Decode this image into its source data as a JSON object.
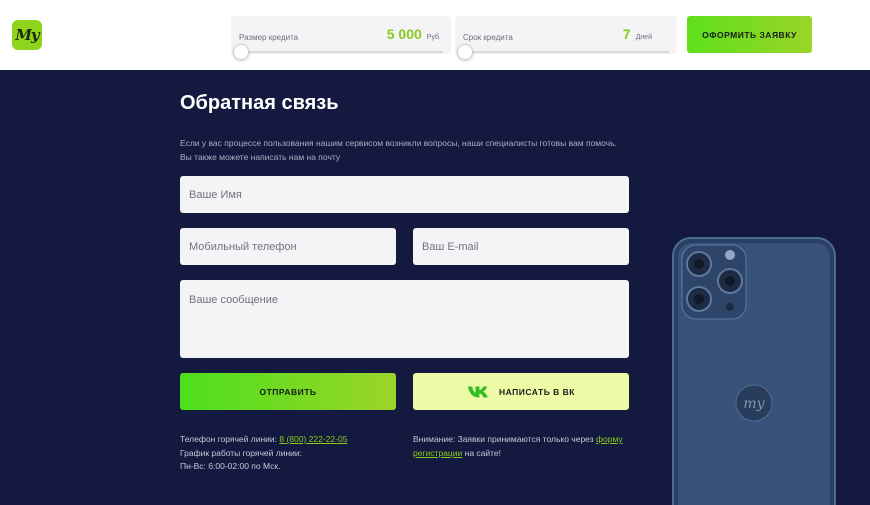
{
  "header": {
    "logo_text": "My",
    "loan_amount": {
      "label": "Размер кредита",
      "value": "5 000",
      "unit": "Руб.",
      "slider_level": 0
    },
    "loan_term": {
      "label": "Срок кредита",
      "value": "7",
      "unit": "Дней",
      "slider_level": 0
    },
    "apply_button": "ОФОРМИТЬ ЗАЯВКУ"
  },
  "feedback": {
    "title": "Обратная связь",
    "description_line1": "Если у вас процессе пользования нашим сервисом возникли вопросы, наши специалисты готовы вам помочь.",
    "description_line2": "Вы также можете написать нам на почту",
    "name_placeholder": "Ваше Имя",
    "phone_placeholder": "Мобильный телефон",
    "email_placeholder": "Ваш E-mail",
    "message_placeholder": "Ваше сообщение",
    "send_button": "ОТПРАВИТЬ",
    "vk_button": "НАПИСАТЬ В ВК"
  },
  "contacts": {
    "hotline_label": "Телефон горячей линии: ",
    "hotline_number": "8 (800) 222-22-05",
    "schedule_label": "График работы горячей линии:",
    "schedule_value": "Пн-Вс: 6:00-02:00 по Мск."
  },
  "notice": {
    "text_before": "Внимание: Заявки принимаются только через ",
    "link_text": "форму регистрации",
    "text_after": " на сайте!"
  },
  "phone_logo": "my",
  "colors": {
    "accent": "#8ac81c",
    "background": "#141a3f",
    "vk_button": "#eefba6"
  }
}
